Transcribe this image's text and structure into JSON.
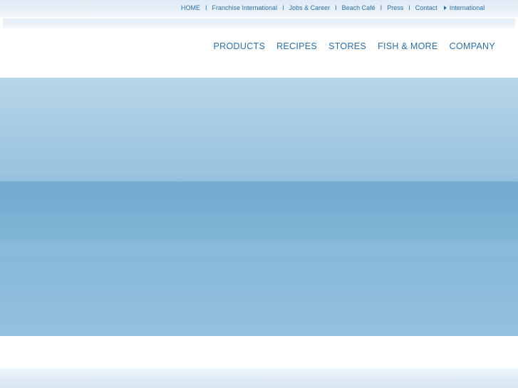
{
  "utility_nav": {
    "items": [
      {
        "label": "HOME"
      },
      {
        "label": "Franchise International"
      },
      {
        "label": "Jobs & Career"
      },
      {
        "label": "Beach Café"
      },
      {
        "label": "Press"
      },
      {
        "label": "Contact"
      }
    ],
    "separator": "I",
    "international": {
      "label": "International",
      "icon": "triangle-right-icon"
    }
  },
  "main_nav": {
    "items": [
      {
        "label": "PRODUCTS"
      },
      {
        "label": "RECIPES"
      },
      {
        "label": "STORES"
      },
      {
        "label": "FISH & MORE"
      },
      {
        "label": "COMPANY"
      }
    ]
  },
  "colors": {
    "link": "#2a6fa6",
    "hero_top": "#b9d6e8",
    "hero_mid": "#78b0d3",
    "hero_bottom": "#93c1df"
  }
}
